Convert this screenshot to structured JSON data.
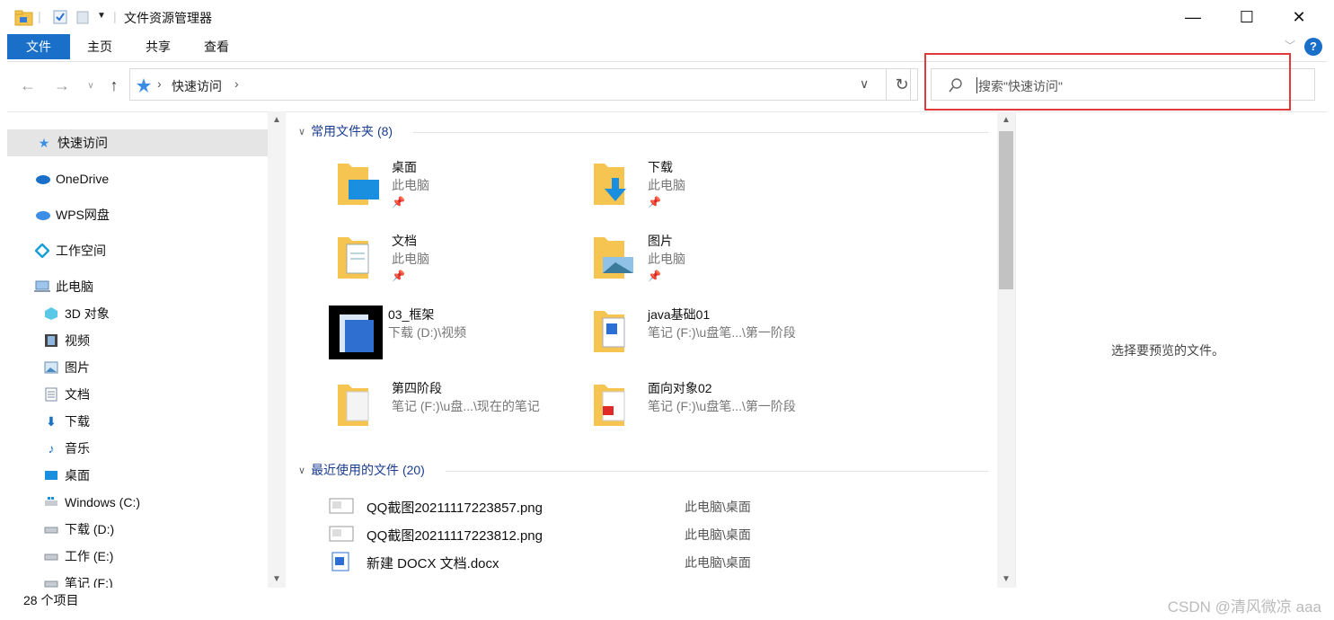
{
  "window": {
    "title": "文件资源管理器"
  },
  "window_controls": {
    "minimize": "—",
    "maximize": "☐",
    "close": "✕"
  },
  "ribbon": {
    "tabs": [
      {
        "label": "文件"
      },
      {
        "label": "主页"
      },
      {
        "label": "共享"
      },
      {
        "label": "查看"
      }
    ],
    "help": "?"
  },
  "address": {
    "crumb": "快速访问"
  },
  "search": {
    "placeholder": "搜索\"快速访问\""
  },
  "nav": {
    "items": [
      {
        "label": "快速访问"
      },
      {
        "label": "OneDrive"
      },
      {
        "label": "WPS网盘"
      },
      {
        "label": "工作空间"
      },
      {
        "label": "此电脑"
      },
      {
        "label": "3D 对象"
      },
      {
        "label": "视频"
      },
      {
        "label": "图片"
      },
      {
        "label": "文档"
      },
      {
        "label": "下载"
      },
      {
        "label": "音乐"
      },
      {
        "label": "桌面"
      },
      {
        "label": "Windows (C:)"
      },
      {
        "label": "下载 (D:)"
      },
      {
        "label": "工作 (E:)"
      },
      {
        "label": "笔记 (F:)"
      }
    ]
  },
  "frequent": {
    "header": "常用文件夹 (8)",
    "tiles": [
      {
        "name": "桌面",
        "sub": "此电脑"
      },
      {
        "name": "下载",
        "sub": "此电脑"
      },
      {
        "name": "文档",
        "sub": "此电脑"
      },
      {
        "name": "图片",
        "sub": "此电脑"
      },
      {
        "name": "03_框架",
        "sub": "下载 (D:)\\视频"
      },
      {
        "name": "java基础01",
        "sub": "笔记 (F:)\\u盘笔...\\第一阶段"
      },
      {
        "name": "第四阶段",
        "sub": "笔记 (F:)\\u盘...\\现在的笔记"
      },
      {
        "name": "面向对象02",
        "sub": "笔记 (F:)\\u盘笔...\\第一阶段"
      }
    ]
  },
  "recent": {
    "header": "最近使用的文件 (20)",
    "rows": [
      {
        "name": "QQ截图20211117223857.png",
        "loc": "此电脑\\桌面"
      },
      {
        "name": "QQ截图20211117223812.png",
        "loc": "此电脑\\桌面"
      },
      {
        "name": "新建 DOCX 文档.docx",
        "loc": "此电脑\\桌面"
      }
    ]
  },
  "preview": {
    "text": "选择要预览的文件。"
  },
  "status": {
    "count": "28 个项目"
  },
  "watermark": "CSDN @清风微凉 aaa",
  "colors": {
    "accent": "#1a6fc9",
    "highlight": "#e03a3a",
    "folder": "#f5c451"
  }
}
